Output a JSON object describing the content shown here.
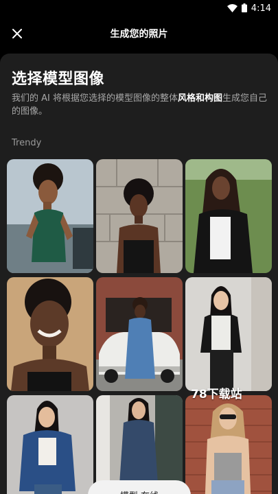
{
  "status_bar": {
    "time": "4:14"
  },
  "header": {
    "title": "生成您的照片"
  },
  "main": {
    "heading": "选择模型图像",
    "desc_before": "我们的 AI 将根据您选择的模型图像的整体",
    "desc_emphasis": "风格和构图",
    "desc_after": "生成您自己的图像。",
    "section_label": "Trendy"
  },
  "watermark": "78下载站",
  "bottom_button": {
    "label": "模型 在线"
  },
  "colors": {
    "background": "#000000",
    "sheet": "#1e1e1e",
    "text_secondary": "#a8a8a8"
  }
}
